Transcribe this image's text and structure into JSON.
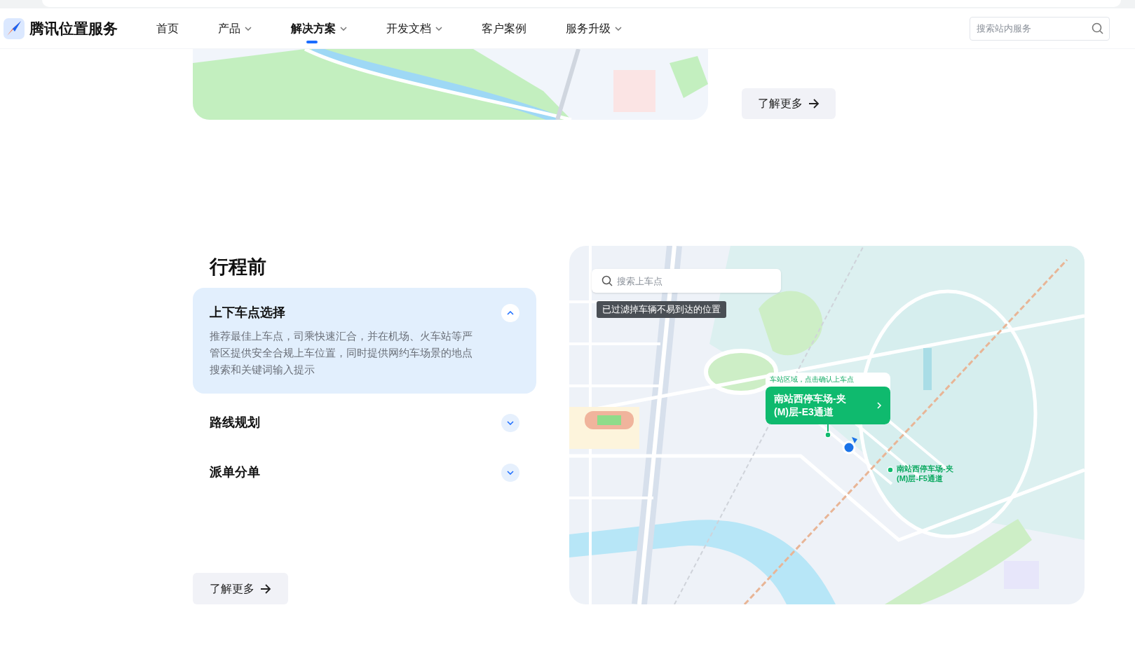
{
  "nav": {
    "logo": "腾讯位置服务",
    "items": [
      {
        "label": "首页",
        "dropdown": false,
        "selected": false
      },
      {
        "label": "产品",
        "dropdown": true,
        "selected": false
      },
      {
        "label": "解决方案",
        "dropdown": true,
        "selected": true
      },
      {
        "label": "开发文档",
        "dropdown": true,
        "selected": false
      },
      {
        "label": "客户案例",
        "dropdown": false,
        "selected": false
      },
      {
        "label": "服务升级",
        "dropdown": true,
        "selected": false
      }
    ],
    "search": {
      "placeholder": "搜索站内服务"
    }
  },
  "top_section": {
    "button": "了解更多"
  },
  "section": {
    "title": "行程前",
    "accordion": [
      {
        "title": "上下车点选择",
        "expanded": true,
        "description": "推荐最佳上车点，司乘快速汇合，并在机场、火车站等严管区提供安全合规上车位置，同时提供网约车场景的地点搜索和关键词输入提示"
      },
      {
        "title": "路线规划",
        "expanded": false
      },
      {
        "title": "派单分单",
        "expanded": false
      }
    ],
    "button": "了解更多"
  },
  "map": {
    "search": {
      "placeholder": "搜索上车点"
    },
    "tooltip": "已过滤掉车辆不易到达的位置",
    "pickup_popup": {
      "caption": "车站区域，点击确认上车点",
      "title": "南站西停车场-夹(M)层-E3通道"
    },
    "markers": [
      {
        "label": "南站西停车场-夹(M)层-F5通道"
      }
    ]
  }
}
